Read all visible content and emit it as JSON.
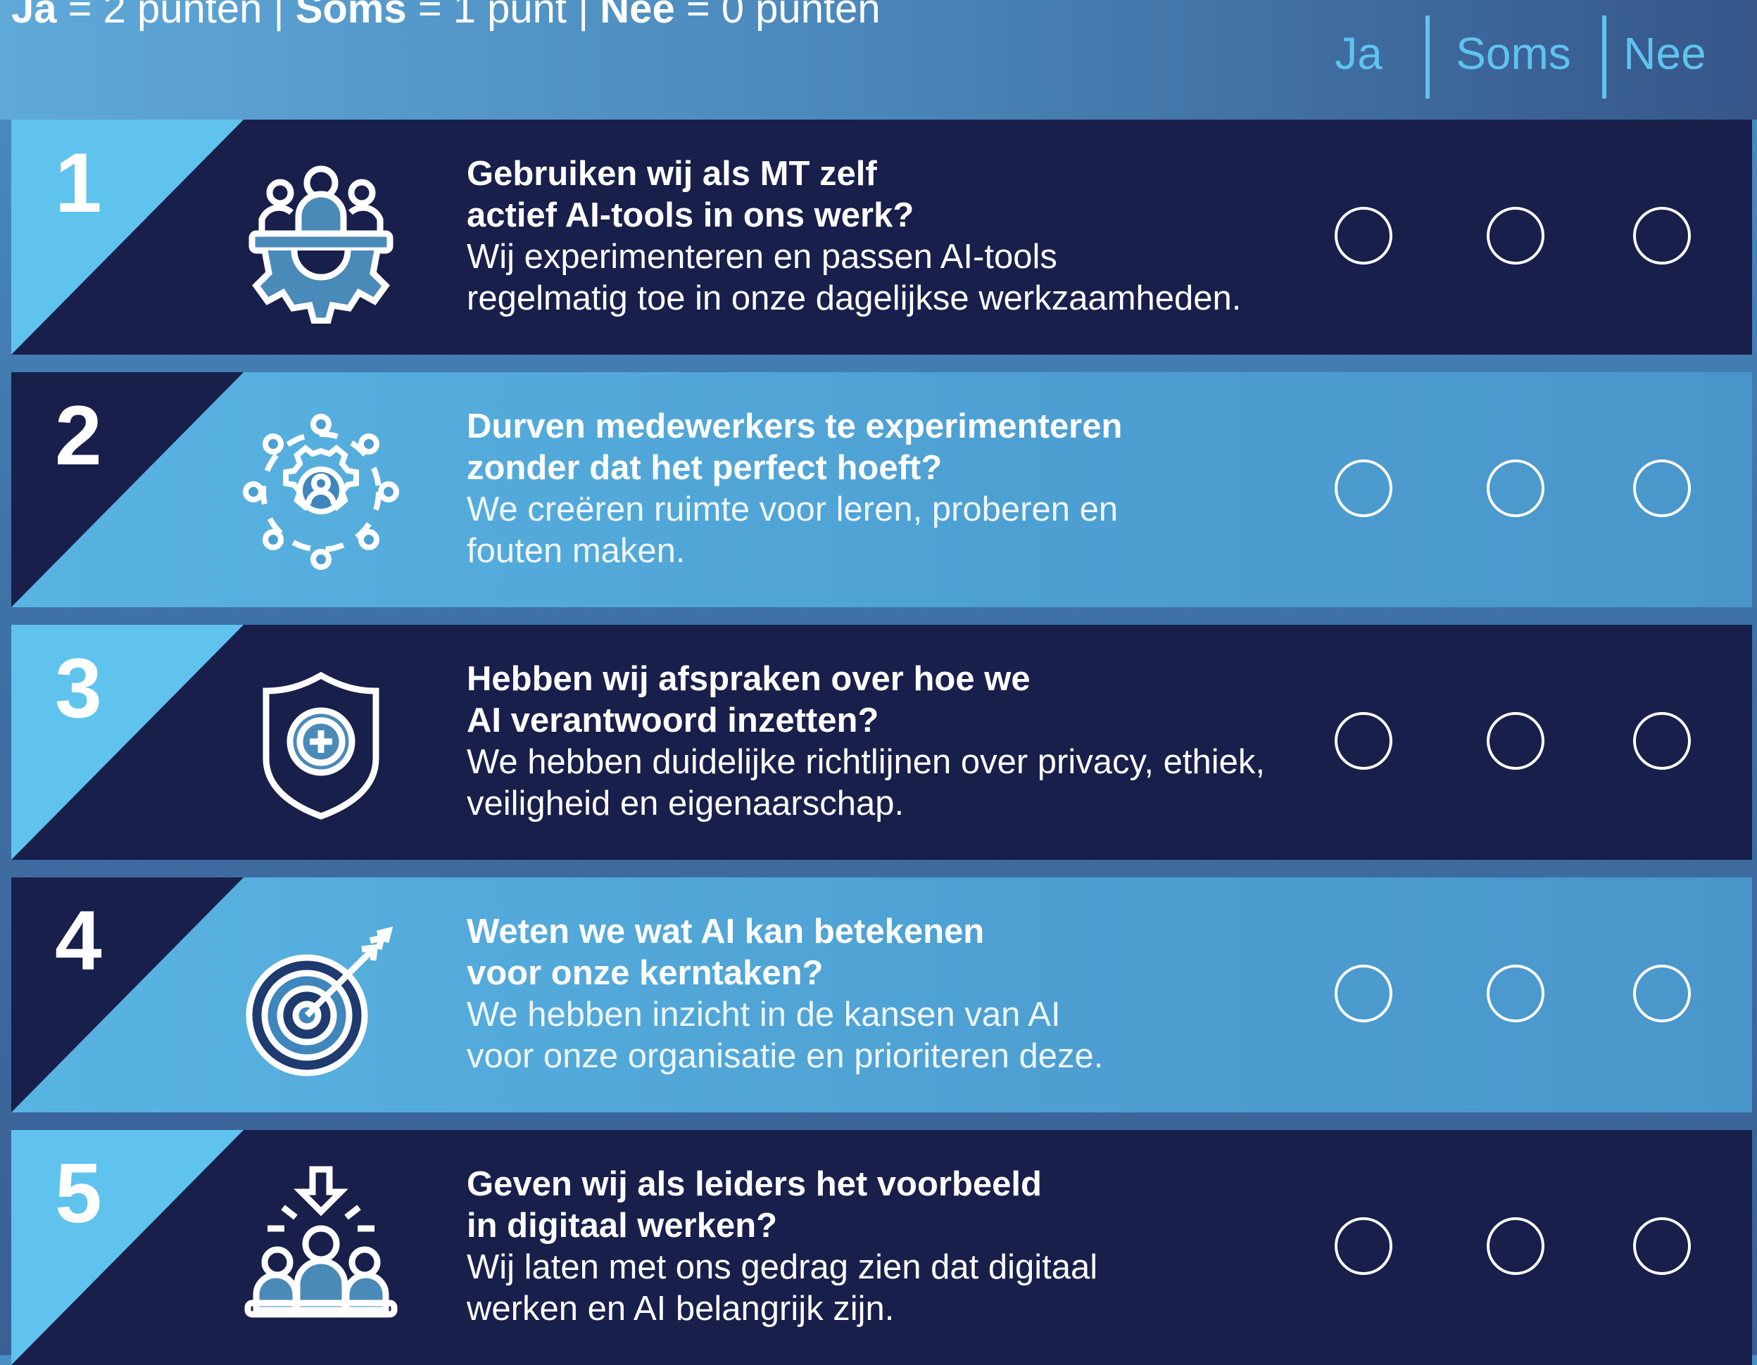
{
  "legend": {
    "ja_label": "Ja",
    "ja_value": " = 2 punten | ",
    "soms_label": "Soms",
    "soms_value": " = 1 punt | ",
    "nee_label": "Nee",
    "nee_value": " = 0 punten"
  },
  "columns": [
    "Ja",
    "Soms",
    "Nee"
  ],
  "colors": {
    "navy": "#181f4b",
    "light_blue": "#5fc3ee",
    "mid_blue": "#4a96cb",
    "white": "#ffffff"
  },
  "rows": [
    {
      "number": "1",
      "question_line1": "Gebruiken wij als MT zelf",
      "question_line2": "actief AI-tools in ons werk?",
      "desc_line1": "Wij experimenteren en passen AI-tools",
      "desc_line2": "regelmatig toe in onze dagelijkse werkzaamheden.",
      "icon": "team-gear-icon"
    },
    {
      "number": "2",
      "question_line1": "Durven medewerkers te experimenteren",
      "question_line2": "zonder dat het perfect hoeft?",
      "desc_line1": "We creëren ruimte voor leren, proberen en",
      "desc_line2": "fouten maken.",
      "icon": "person-gear-network-icon"
    },
    {
      "number": "3",
      "question_line1": "Hebben wij afspraken over hoe we",
      "question_line2": "AI verantwoord inzetten?",
      "desc_line1": "We hebben duidelijke richtlijnen over privacy, ethiek,",
      "desc_line2": "veiligheid en eigenaarschap.",
      "icon": "shield-plus-icon"
    },
    {
      "number": "4",
      "question_line1": "Weten we wat AI kan betekenen",
      "question_line2": "voor onze kerntaken?",
      "desc_line1": "We hebben inzicht in de kansen van AI",
      "desc_line2": "voor onze organisatie en prioriteren deze.",
      "icon": "target-arrow-icon"
    },
    {
      "number": "5",
      "question_line1": "Geven wij als leiders het voorbeeld",
      "question_line2": "in digitaal werken?",
      "desc_line1": "Wij laten met ons gedrag zien dat digitaal",
      "desc_line2": "werken en AI belangrijk zijn.",
      "icon": "leader-team-icon"
    }
  ]
}
